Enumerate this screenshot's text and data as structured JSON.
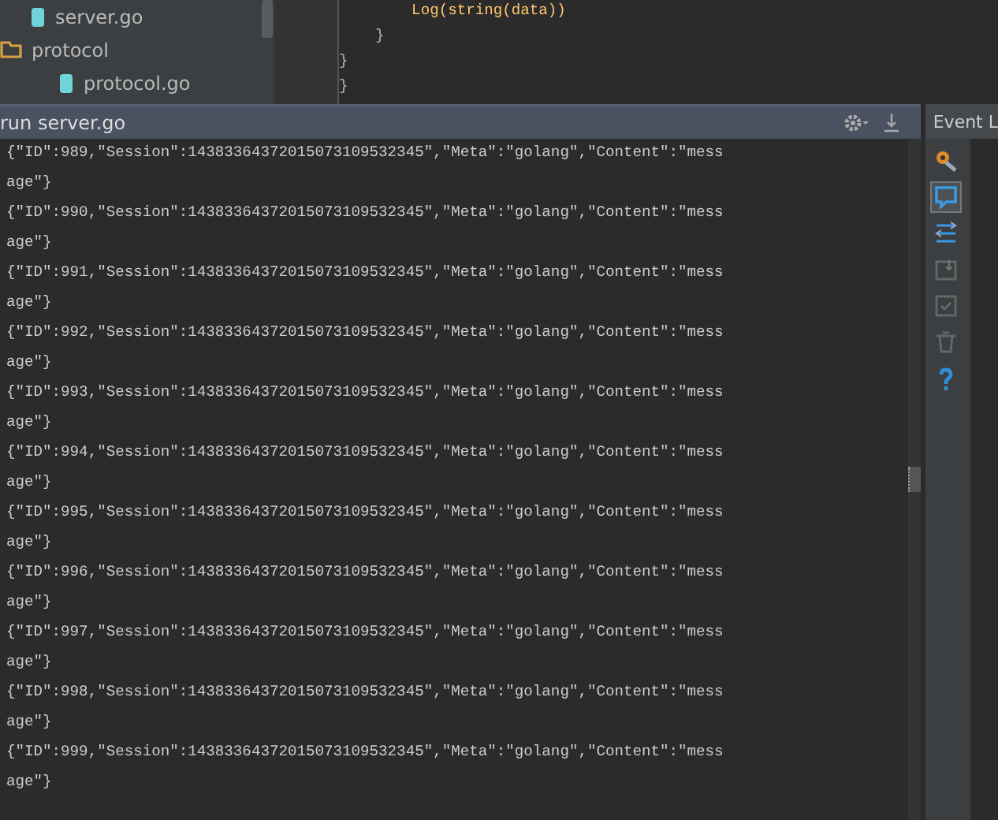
{
  "project_tree": [
    {
      "label": "server.go",
      "kind": "file"
    },
    {
      "label": "protocol",
      "kind": "folder",
      "children": [
        {
          "label": "protocol.go",
          "kind": "file"
        }
      ]
    }
  ],
  "editor": {
    "lines": [
      "        Log(string(data))",
      "    }",
      "}",
      "}"
    ]
  },
  "run_panel": {
    "title": "run server.go",
    "console_lines": [
      "{\"ID\":989,\"Session\":14383364372015073109532345\",\"Meta\":\"golang\",\"Content\":\"mess",
      "age\"}",
      "{\"ID\":990,\"Session\":14383364372015073109532345\",\"Meta\":\"golang\",\"Content\":\"mess",
      "age\"}",
      "{\"ID\":991,\"Session\":14383364372015073109532345\",\"Meta\":\"golang\",\"Content\":\"mess",
      "age\"}",
      "{\"ID\":992,\"Session\":14383364372015073109532345\",\"Meta\":\"golang\",\"Content\":\"mess",
      "age\"}",
      "{\"ID\":993,\"Session\":14383364372015073109532345\",\"Meta\":\"golang\",\"Content\":\"mess",
      "age\"}",
      "{\"ID\":994,\"Session\":14383364372015073109532345\",\"Meta\":\"golang\",\"Content\":\"mess",
      "age\"}",
      "{\"ID\":995,\"Session\":14383364372015073109532345\",\"Meta\":\"golang\",\"Content\":\"mess",
      "age\"}",
      "{\"ID\":996,\"Session\":14383364372015073109532345\",\"Meta\":\"golang\",\"Content\":\"mess",
      "age\"}",
      "{\"ID\":997,\"Session\":14383364372015073109532345\",\"Meta\":\"golang\",\"Content\":\"mess",
      "age\"}",
      "{\"ID\":998,\"Session\":14383364372015073109532345\",\"Meta\":\"golang\",\"Content\":\"mess",
      "age\"}",
      "{\"ID\":999,\"Session\":14383364372015073109532345\",\"Meta\":\"golang\",\"Content\":\"mess",
      "age\"}"
    ]
  },
  "event_log": {
    "title": "Event L",
    "tools": [
      {
        "kind": "settings",
        "selected": false
      },
      {
        "kind": "balloon",
        "selected": true
      },
      {
        "kind": "list",
        "selected": false
      },
      {
        "kind": "export",
        "selected": false
      },
      {
        "kind": "check",
        "selected": false
      },
      {
        "kind": "trash",
        "selected": false
      },
      {
        "kind": "help",
        "selected": false
      }
    ]
  }
}
